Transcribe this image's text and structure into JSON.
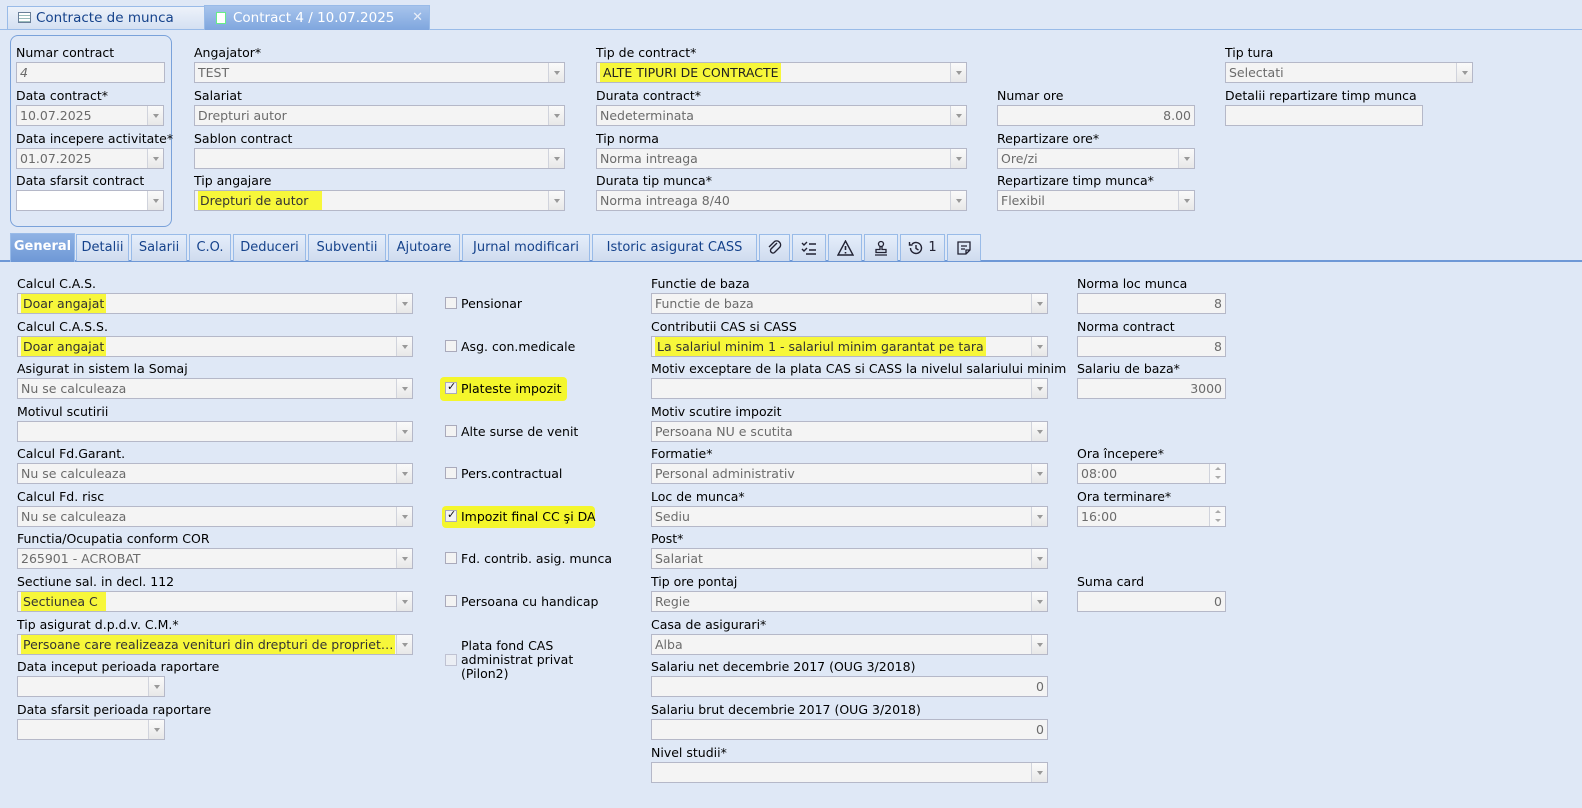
{
  "top_tabs": [
    {
      "label": "Contracte de munca"
    },
    {
      "label": "Contract 4 / 10.07.2025"
    }
  ],
  "header": {
    "numar_contract": {
      "label": "Numar contract",
      "value": "4"
    },
    "data_contract": {
      "label": "Data contract*",
      "value": "10.07.2025"
    },
    "data_incepere": {
      "label": "Data incepere activitate*",
      "value": "01.07.2025"
    },
    "data_sfarsit": {
      "label": "Data sfarsit contract",
      "value": ""
    },
    "angajator": {
      "label": "Angajator*",
      "value": "TEST"
    },
    "salariat": {
      "label": "Salariat",
      "value": "Drepturi autor"
    },
    "sablon": {
      "label": "Sablon contract",
      "value": ""
    },
    "tip_angajare": {
      "label": "Tip angajare",
      "value": "Drepturi de autor"
    },
    "tip_contract": {
      "label": "Tip de contract*",
      "value": "ALTE TIPURI DE CONTRACTE"
    },
    "durata_contract": {
      "label": "Durata contract*",
      "value": "Nedeterminata"
    },
    "tip_norma": {
      "label": "Tip norma",
      "value": "Norma intreaga"
    },
    "durata_tip_munca": {
      "label": "Durata tip munca*",
      "value": "Norma intreaga 8/40"
    },
    "numar_ore": {
      "label": "Numar ore",
      "value": "8.00"
    },
    "repartizare_ore": {
      "label": "Repartizare ore*",
      "value": "Ore/zi"
    },
    "repartizare_timp": {
      "label": "Repartizare timp munca*",
      "value": "Flexibil"
    },
    "tip_tura": {
      "label": "Tip tura",
      "value": "Selectati"
    },
    "detalii_repartizare": {
      "label": "Detalii repartizare timp munca",
      "value": ""
    }
  },
  "sub_tabs": [
    "General",
    "Detalii",
    "Salarii",
    "C.O.",
    "Deduceri",
    "Subventii",
    "Ajutoare",
    "Jurnal modificari",
    "Istoric asigurat CASS"
  ],
  "history_count": "1",
  "general": {
    "col1": [
      {
        "label": "Calcul C.A.S.",
        "value": "Doar angajat"
      },
      {
        "label": "Calcul C.A.S.S.",
        "value": "Doar angajat"
      },
      {
        "label": "Asigurat in sistem la Somaj",
        "value": "Nu se calculeaza"
      },
      {
        "label": "Motivul scutirii",
        "value": ""
      },
      {
        "label": "Calcul Fd.Garant.",
        "value": "Nu se calculeaza"
      },
      {
        "label": "Calcul Fd. risc",
        "value": "Nu se calculeaza"
      },
      {
        "label": "Functia/Ocupatia conform COR",
        "value": "265901 - ACROBAT"
      },
      {
        "label": "Sectiune sal. in decl. 112",
        "value": "Sectiunea C"
      },
      {
        "label": "Tip asigurat d.p.d.v. C.M.*",
        "value": "Persoane care realizeaza venituri din drepturi de propriet…"
      },
      {
        "label": "Data inceput perioada raportare",
        "value": ""
      },
      {
        "label": "Data sfarsit perioada raportare",
        "value": ""
      }
    ],
    "checks": [
      {
        "label": "Pensionar",
        "checked": false
      },
      {
        "label": "Asg. con.medicale",
        "checked": false
      },
      {
        "label": "Plateste impozit",
        "checked": true
      },
      {
        "label": "Alte surse de venit",
        "checked": false
      },
      {
        "label": "Pers.contractual",
        "checked": false
      },
      {
        "label": "Impozit final CC şi DA",
        "checked": true
      },
      {
        "label": "Fd. contrib. asig. munca",
        "checked": false
      },
      {
        "label": "Persoana cu handicap",
        "checked": false
      }
    ],
    "pilon2": {
      "line1": "Plata fond CAS",
      "line2": "administrat privat",
      "line3": "(Pilon2)"
    },
    "col3": [
      {
        "label": "Functie de baza",
        "value": "Functie de baza"
      },
      {
        "label": "Contributii CAS si CASS",
        "value": "La salariul minim 1 - salariul minim garantat pe tara"
      },
      {
        "label": "Motiv exceptare de la plata CAS si CASS la nivelul salariului minim",
        "value": ""
      },
      {
        "label": "Motiv scutire impozit",
        "value": "Persoana NU e scutita"
      },
      {
        "label": "Formatie*",
        "value": "Personal administrativ"
      },
      {
        "label": "Loc de munca*",
        "value": "Sediu"
      },
      {
        "label": "Post*",
        "value": "Salariat"
      },
      {
        "label": "Tip ore pontaj",
        "value": "Regie"
      },
      {
        "label": "Casa de asigurari*",
        "value": "Alba"
      },
      {
        "label": "Salariu net decembrie 2017 (OUG 3/2018)",
        "value": "0"
      },
      {
        "label": "Salariu brut decembrie 2017 (OUG 3/2018)",
        "value": "0"
      },
      {
        "label": "Nivel studii*",
        "value": ""
      }
    ],
    "col4": {
      "norma_loc": {
        "label": "Norma loc munca",
        "value": "8"
      },
      "norma_contract": {
        "label": "Norma contract",
        "value": "8"
      },
      "salariu_baza": {
        "label": "Salariu de baza*",
        "value": "3000"
      },
      "ora_incepere": {
        "label": "Ora începere*",
        "value": "08:00"
      },
      "ora_terminare": {
        "label": "Ora terminare*",
        "value": "16:00"
      },
      "suma_card": {
        "label": "Suma card",
        "value": "0"
      }
    }
  },
  "colors": {
    "highlight": "#f4f62c",
    "tab_active": "#6e98d6",
    "bg": "#dfe8f6"
  }
}
